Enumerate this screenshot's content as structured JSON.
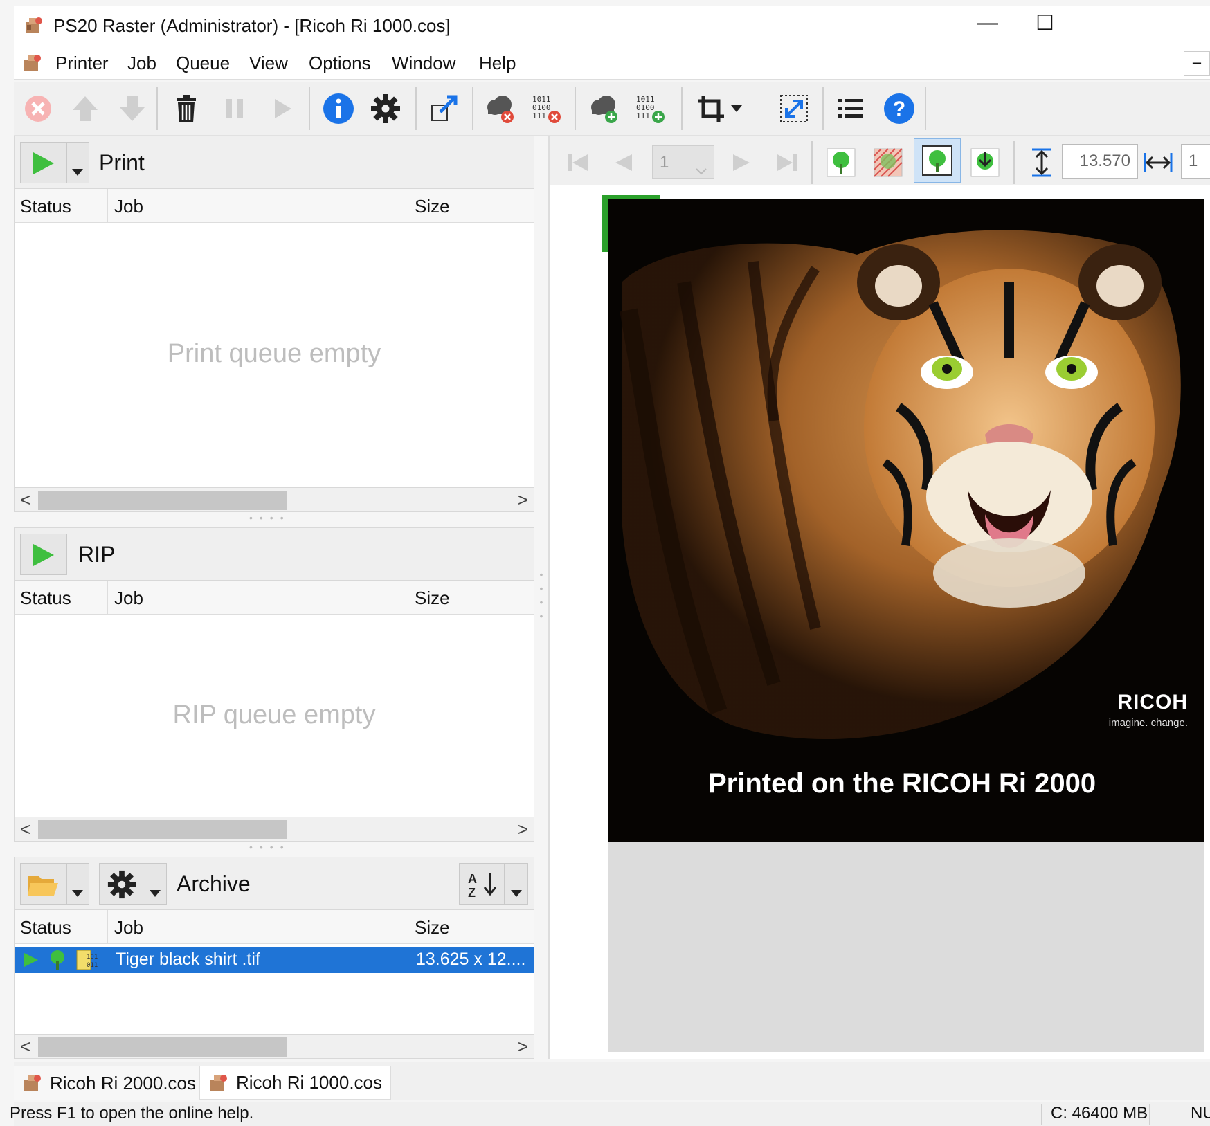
{
  "window": {
    "title": "PS20 Raster (Administrator) - [Ricoh Ri 1000.cos]",
    "minimize": "—",
    "maximize": "☐",
    "mdi_minimize": "–"
  },
  "menu": [
    "Printer",
    "Job",
    "Queue",
    "View",
    "Options",
    "Window",
    "Help"
  ],
  "print_queue": {
    "title": "Print",
    "columns": [
      "Status",
      "Job",
      "Size"
    ],
    "empty_text": "Print queue empty"
  },
  "rip_queue": {
    "title": "RIP",
    "columns": [
      "Status",
      "Job",
      "Size"
    ],
    "empty_text": "RIP queue empty"
  },
  "archive": {
    "title": "Archive",
    "columns": [
      "Status",
      "Job",
      "Size"
    ],
    "rows": [
      {
        "job": "Tiger black shirt .tif",
        "size": "13.625 x 12...."
      }
    ]
  },
  "preview_toolbar": {
    "page": "1",
    "height_value": "13.570",
    "width_value_partial": "1"
  },
  "preview": {
    "brand": "RICOH",
    "tagline": "imagine. change.",
    "caption": "Printed on the RICOH Ri 2000"
  },
  "tabs": [
    "Ricoh Ri 2000.cos",
    "Ricoh Ri 1000.cos"
  ],
  "status": {
    "help": "Press F1 to open the online help.",
    "disk": "C: 46400 MB",
    "num": "NUM"
  },
  "colors": {
    "selection": "#1f74d6",
    "accent_green": "#2ba02b",
    "info_blue": "#1a73e8"
  }
}
